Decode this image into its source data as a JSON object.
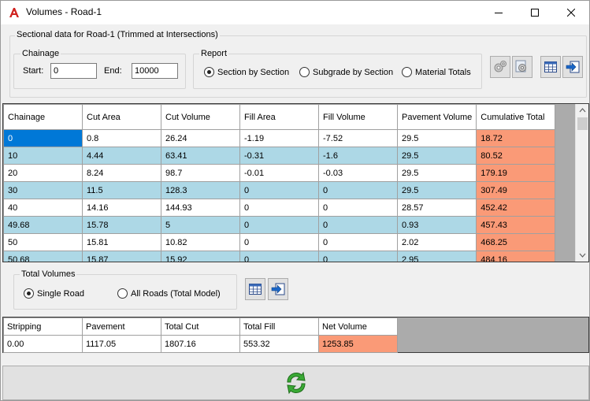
{
  "window": {
    "title": "Volumes - Road-1",
    "minimize_icon": "minimize-icon",
    "maximize_icon": "maximize-icon",
    "close_icon": "close-icon"
  },
  "sectional": {
    "group_label": "Sectional data for Road-1 (Trimmed at Intersections)",
    "chainage": {
      "label": "Chainage",
      "start_label": "Start:",
      "start_value": "0",
      "end_label": "End:",
      "end_value": "10000"
    },
    "report": {
      "label": "Report",
      "options": [
        "Section by Section",
        "Subgrade by Section",
        "Material Totals"
      ],
      "selected": "Section by Section"
    }
  },
  "grid": {
    "headers": [
      "Chainage",
      "Cut Area",
      "Cut Volume",
      "Fill Area",
      "Fill Volume",
      "Pavement Volume",
      "Cumulative Total"
    ],
    "rows": [
      [
        "0",
        "0.8",
        "26.24",
        "-1.19",
        "-7.52",
        "29.5",
        "18.72"
      ],
      [
        "10",
        "4.44",
        "63.41",
        "-0.31",
        "-1.6",
        "29.5",
        "80.52"
      ],
      [
        "20",
        "8.24",
        "98.7",
        "-0.01",
        "-0.03",
        "29.5",
        "179.19"
      ],
      [
        "30",
        "11.5",
        "128.3",
        "0",
        "0",
        "29.5",
        "307.49"
      ],
      [
        "40",
        "14.16",
        "144.93",
        "0",
        "0",
        "28.57",
        "452.42"
      ],
      [
        "49.68",
        "15.78",
        "5",
        "0",
        "0",
        "0.93",
        "457.43"
      ],
      [
        "50",
        "15.81",
        "10.82",
        "0",
        "0",
        "2.02",
        "468.25"
      ],
      [
        "50.68",
        "15.87",
        "15.92",
        "0",
        "0",
        "2.95",
        "484.16"
      ]
    ]
  },
  "total_volumes": {
    "label": "Total Volumes",
    "options": [
      "Single Road",
      "All Roads (Total Model)"
    ],
    "selected": "Single Road"
  },
  "totals_grid": {
    "headers": [
      "Stripping",
      "Pavement",
      "Total Cut",
      "Total Fill",
      "Net Volume"
    ],
    "values": [
      "0.00",
      "1117.05",
      "1807.16",
      "553.32",
      "1253.85"
    ]
  },
  "colors": {
    "row_alt": "#add8e6",
    "highlight": "#fa9a77",
    "selection": "#0078d7"
  }
}
